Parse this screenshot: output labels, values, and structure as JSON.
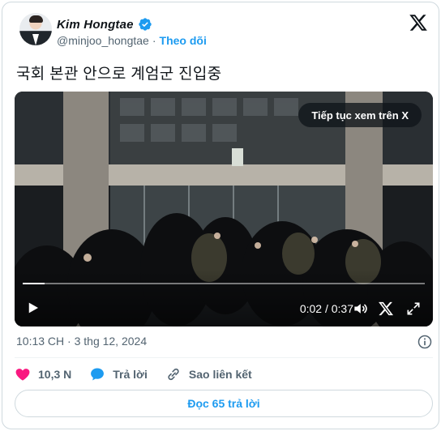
{
  "author": {
    "display_name": "Kim Hongtae",
    "handle": "@minjoo_hongtae",
    "separator": "·",
    "follow_label": "Theo dõi"
  },
  "tweet": {
    "text": "국회 본관 안으로 계엄군 진입중",
    "timestamp": "10:13 CH · 3 thg 12, 2024"
  },
  "video": {
    "continue_label": "Tiếp tục xem trên X",
    "time_display": "0:02 / 0:37",
    "progress": 0.054
  },
  "actions": {
    "likes": "10,3 N",
    "reply_label": "Trả lời",
    "copy_link_label": "Sao liên kết"
  },
  "read_replies_label": "Đọc 65 trả lời",
  "colors": {
    "accent": "#1d9bf0",
    "like": "#f91880",
    "secondary_text": "#536471"
  },
  "icons": {
    "verified": "verified-badge-icon",
    "brand": "x-logo-icon",
    "play": "play-icon",
    "volume": "volume-icon",
    "fullscreen": "fullscreen-icon",
    "info": "info-icon",
    "like": "heart-icon",
    "reply": "reply-bubble-icon",
    "link": "link-icon"
  }
}
